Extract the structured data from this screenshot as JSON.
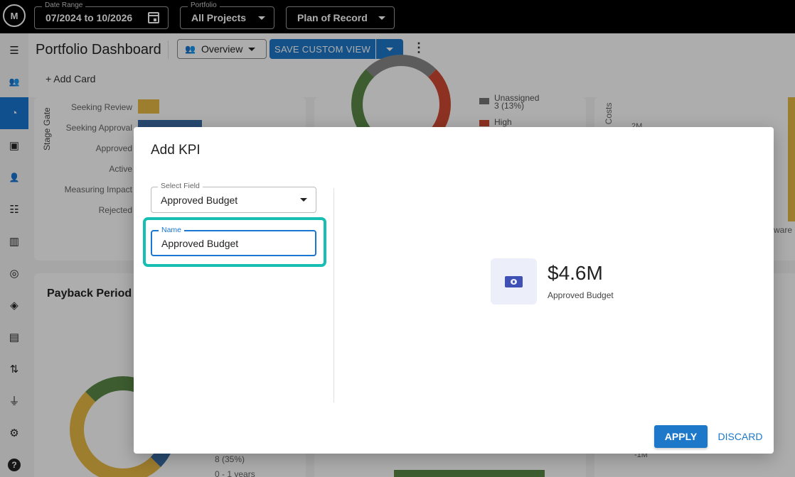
{
  "topbar": {
    "logo_text": "M",
    "date_range": {
      "label": "Date Range",
      "value": "07/2024 to 10/2026"
    },
    "portfolio": {
      "label": "Portfolio",
      "value": "All Projects"
    },
    "plan": {
      "value": "Plan of Record"
    }
  },
  "sidebar": {
    "items": [
      {
        "icon": "menu-icon",
        "glyph": "☰"
      },
      {
        "icon": "users-list-icon",
        "glyph": "👥"
      },
      {
        "icon": "dashboard-icon",
        "glyph": "◔"
      },
      {
        "icon": "badge-icon",
        "glyph": "▣"
      },
      {
        "icon": "people-icon",
        "glyph": "👤"
      },
      {
        "icon": "list-icon",
        "glyph": "☷"
      },
      {
        "icon": "columns-icon",
        "glyph": "▥"
      },
      {
        "icon": "target-icon",
        "glyph": "◎"
      },
      {
        "icon": "route-icon",
        "glyph": "◈"
      },
      {
        "icon": "document-icon",
        "glyph": "▤"
      },
      {
        "icon": "swap-icon",
        "glyph": "⇅"
      },
      {
        "icon": "plug-icon",
        "glyph": "⏚"
      },
      {
        "icon": "gear-icon",
        "glyph": "⚙"
      },
      {
        "icon": "help-icon",
        "glyph": "?"
      }
    ]
  },
  "header": {
    "title": "Portfolio Dashboard",
    "view_select": "Overview",
    "save_label": "SAVE CUSTOM VIEW",
    "add_card_label": "+ Add Card"
  },
  "background": {
    "stage_gate_axis": "Stage Gate",
    "stages": [
      "Seeking Review",
      "Seeking Approval",
      "Approved",
      "Active",
      "Measuring Impact",
      "Rejected"
    ],
    "legend_unassigned": "Unassigned",
    "legend_unassigned_count": "3 (13%)",
    "legend_high": "High",
    "axis_2m": "2M",
    "axis_neg1m": "-1M",
    "axis_cost": "ed Costs",
    "axis_ware": "ware I",
    "payback_title": "Payback Period",
    "legend_35": "8 (35%)",
    "legend_years": "0 - 1 years"
  },
  "modal": {
    "title": "Add KPI",
    "select_field": {
      "label": "Select Field",
      "value": "Approved Budget"
    },
    "name_field": {
      "label": "Name",
      "value": "Approved Budget"
    },
    "preview": {
      "value": "$4.6M",
      "label": "Approved Budget"
    },
    "apply_label": "APPLY",
    "discard_label": "DISCARD"
  }
}
